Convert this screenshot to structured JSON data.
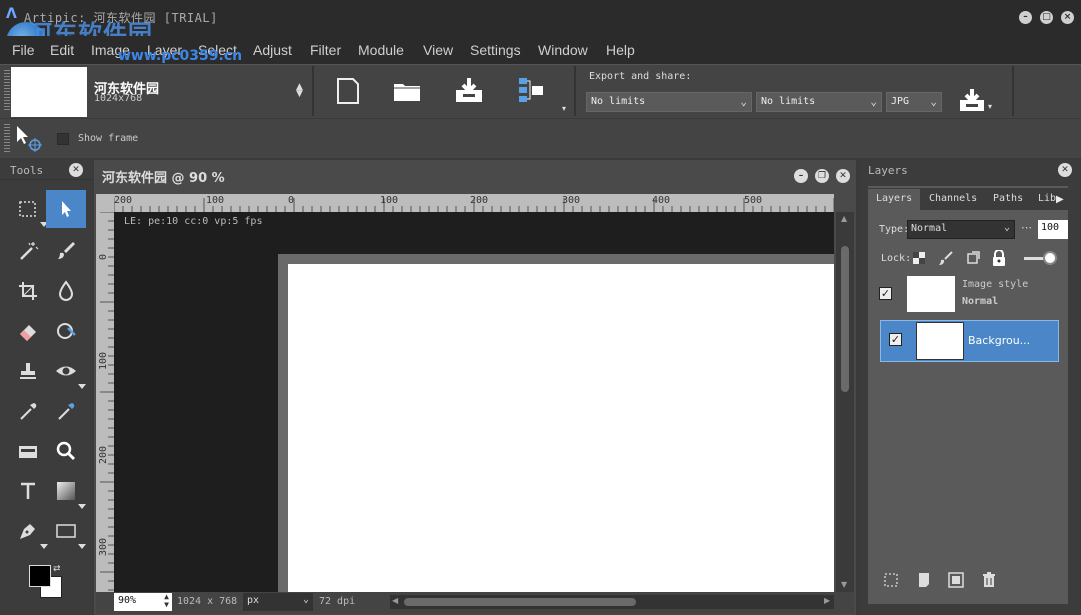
{
  "window": {
    "title": "Artipic: 河东软件园 [TRIAL]",
    "watermark": "河东软件园",
    "watermark_url": "www.pc0359.cn"
  },
  "menu": [
    "File",
    "Edit",
    "Image",
    "Layer",
    "Select",
    "Adjust",
    "Filter",
    "Module",
    "View",
    "Settings",
    "Window",
    "Help"
  ],
  "document": {
    "name": "河东软件园",
    "size": "1024x768"
  },
  "export": {
    "label": "Export and share:",
    "limit1": "No limits",
    "limit2": "No limits",
    "format": "JPG"
  },
  "options": {
    "show_frame_label": "Show frame"
  },
  "tools_panel": {
    "title": "Tools",
    "tools": [
      "marquee-icon",
      "move-pointer-icon",
      "magic-wand-icon",
      "brush-icon",
      "crop-icon",
      "drop-icon",
      "eraser-icon",
      "blur-icon",
      "stamp-icon",
      "eye-icon",
      "eyedropper-icon",
      "color-picker-icon",
      "paint-bucket-icon",
      "zoom-icon",
      "text-icon",
      "gradient-icon",
      "pen-icon",
      "rectangle-shape-icon"
    ],
    "fg_color": "#000000",
    "bg_color": "#ffffff"
  },
  "canvas": {
    "title": "河东软件园 @ 90 %",
    "status": "LE: pe:10 cc:0 vp:5 fps",
    "ruler_top_labels": [
      "200",
      "100",
      "0",
      "100",
      "200",
      "300",
      "400",
      "500"
    ],
    "ruler_left_labels": [
      "0",
      "100",
      "200",
      "300"
    ],
    "zoom": "90%",
    "dims": "1024 x 768",
    "unit": "px",
    "dpi": "72 dpi"
  },
  "layers_panel": {
    "title": "Layers",
    "tabs": [
      "Layers",
      "Channels",
      "Paths",
      "Lib"
    ],
    "type_label": "Type:",
    "blend_mode": "Normal",
    "opacity": "100",
    "lock_label": "Lock:",
    "layers": [
      {
        "name": "Image style",
        "mode": "Normal",
        "checked": true
      },
      {
        "name": "Backgrou...",
        "checked": true
      }
    ]
  },
  "colors": {
    "accent": "#4a86c8",
    "titlebar": "#2b2b2b",
    "panel": "#3c3c3c"
  }
}
